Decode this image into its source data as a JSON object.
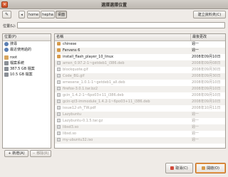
{
  "window": {
    "title": "選擇選擇位置",
    "close_glyph": "×"
  },
  "toolbar": {
    "pathbar_toggle_glyph": "✎",
    "path_left_glyph": "◂",
    "path": [
      "home",
      "hepha",
      "桌面"
    ],
    "create_folder_label": "建立資料夾(C)"
  },
  "location": {
    "label": "位置(L):",
    "value": ""
  },
  "places": {
    "header": "位置(P)",
    "items": [
      {
        "label": "搜尋",
        "icon": "search-icon"
      },
      {
        "label": "最近使用過的",
        "icon": "recent-icon"
      },
      {
        "label": "",
        "icon": "separator"
      },
      {
        "label": "root",
        "icon": "home-icon"
      },
      {
        "label": "檔案系統",
        "icon": "drive-icon"
      },
      {
        "label": "387.5 GB 檔案",
        "icon": "drive-icon"
      },
      {
        "label": "10.5 GB 檔案",
        "icon": "drive-icon"
      }
    ],
    "add_label": "+ 新增(A)",
    "remove_label": "− 移除(R)"
  },
  "files": {
    "col_name": "名稱",
    "col_modified": "最後更改",
    "rows": [
      {
        "name": "chinese",
        "modified": "週一",
        "icon": "folder-icon",
        "dim": false
      },
      {
        "name": "Fervens 6",
        "modified": "週一",
        "icon": "folder-icon",
        "dim": false
      },
      {
        "name": "install_flash_player_10_linux",
        "modified": "2008年09月10日",
        "icon": "folder-icon",
        "dim": false
      },
      {
        "name": "amsn_0.97.2-1~getdeb1_i386.deb",
        "modified": "2008年09月08日",
        "icon": "doc-icon",
        "dim": true
      },
      {
        "name": "blockquote.gif",
        "modified": "2008年09月30日",
        "icon": "doc-icon",
        "dim": true
      },
      {
        "name": "Code_BG.gif",
        "modified": "2008年09月30日",
        "icon": "doc-icon",
        "dim": true
      },
      {
        "name": "emesene_1.0.1-1~getdeb1_all.deb",
        "modified": "2008年09月10日",
        "icon": "doc-icon",
        "dim": true
      },
      {
        "name": "firefox-3.0.1.tar.bz2",
        "modified": "2008年09月10日",
        "icon": "doc-icon",
        "dim": true
      },
      {
        "name": "gcin_1.4.2-1~6po03+11_i386.deb",
        "modified": "2008年09月10日",
        "icon": "doc-icon",
        "dim": true
      },
      {
        "name": "gcin-qt3-immodule_1.4.2-1~6po03+11_i386.deb",
        "modified": "2008年09月10日",
        "icon": "doc-icon",
        "dim": true
      },
      {
        "name": "issue12-zh_TW.pdf",
        "modified": "2008年10月11日",
        "icon": "doc-icon",
        "dim": true
      },
      {
        "name": "Lazybuntu",
        "modified": "週一",
        "icon": "doc-icon",
        "dim": true
      },
      {
        "name": "Lazybuntu-0.1.5.tar.gz",
        "modified": "週一",
        "icon": "doc-icon",
        "dim": true
      },
      {
        "name": "libsd3.so",
        "modified": "週一",
        "icon": "doc-icon",
        "dim": true
      },
      {
        "name": "libsd.so",
        "modified": "週一",
        "icon": "doc-icon",
        "dim": true
      },
      {
        "name": "my-ubuntu32.iso",
        "modified": "週一",
        "icon": "doc-icon",
        "dim": true
      }
    ]
  },
  "buttons": {
    "cancel_label": "取消(C)",
    "open_label": "開啟(O)"
  }
}
